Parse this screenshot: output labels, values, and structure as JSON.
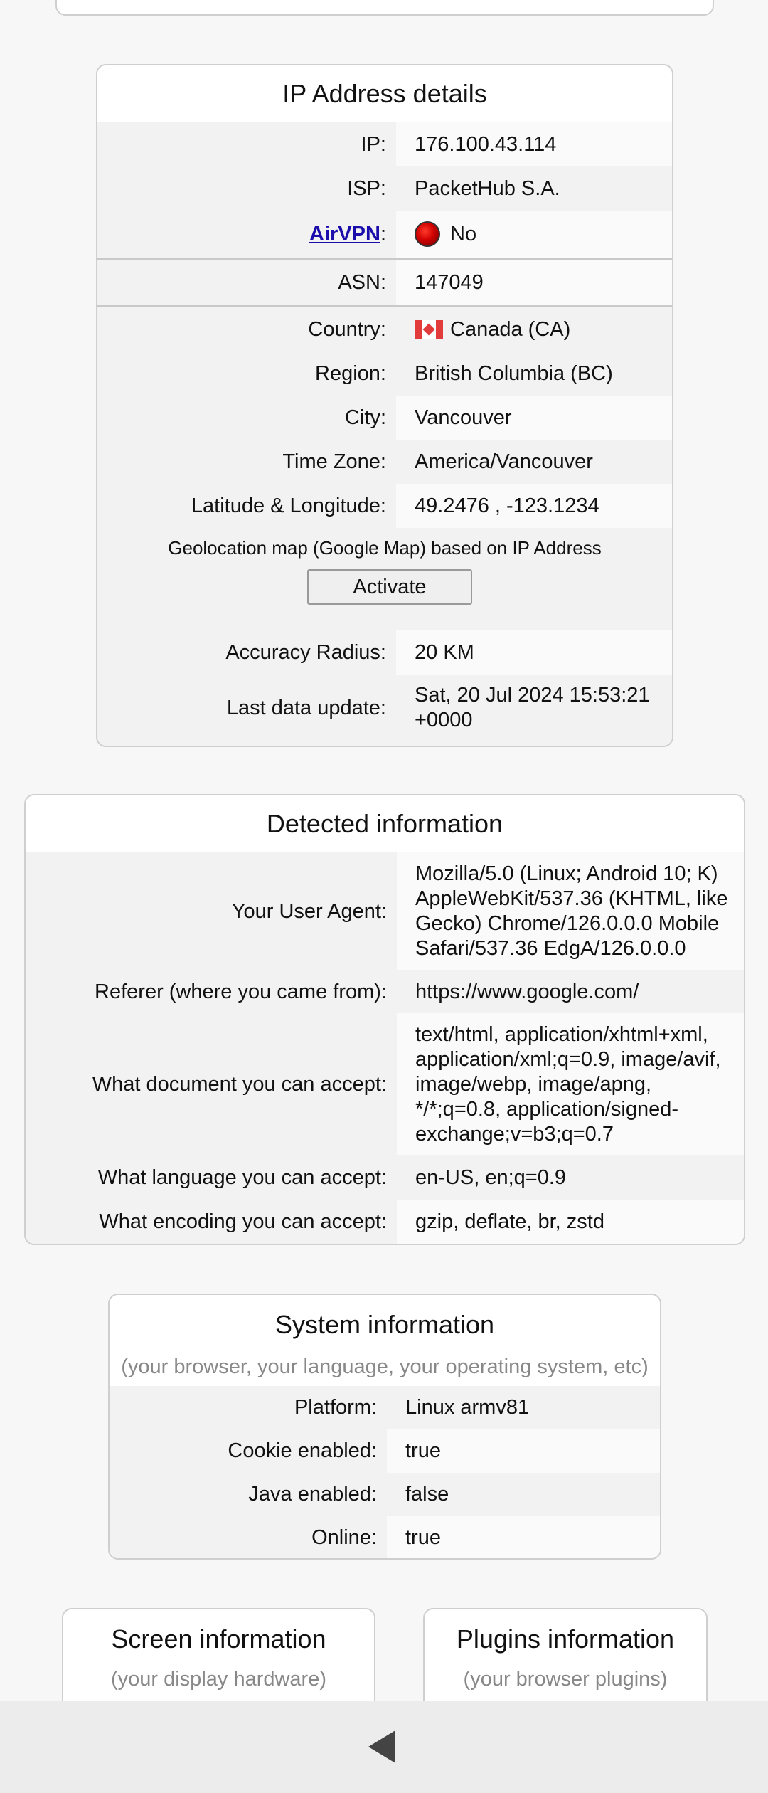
{
  "ip_card": {
    "title": "IP Address details",
    "ip_label": "IP:",
    "ip_value": "176.100.43.114",
    "isp_label": "ISP:",
    "isp_value": "PacketHub S.A.",
    "airvpn_link": "AirVPN",
    "airvpn_colon": ":",
    "airvpn_value": "No",
    "asn_label": "ASN:",
    "asn_value": "147049",
    "country_label": "Country:",
    "country_value": "Canada (CA)",
    "region_label": "Region:",
    "region_value": "British Columbia (BC)",
    "city_label": "City:",
    "city_value": "Vancouver",
    "timezone_label": "Time Zone:",
    "timezone_value": "America/Vancouver",
    "latlng_label": "Latitude & Longitude:",
    "latlng_value": "49.2476 , -123.1234",
    "map_note": "Geolocation map (Google Map) based on IP Address",
    "activate_button": "Activate",
    "accuracy_label": "Accuracy Radius:",
    "accuracy_value": "20 KM",
    "lastupdate_label": "Last data update:",
    "lastupdate_value": "Sat, 20 Jul 2024 15:53:21 +0000"
  },
  "detected_card": {
    "title": "Detected information",
    "ua_label": "Your User Agent:",
    "ua_value": "Mozilla/5.0 (Linux; Android 10; K) AppleWebKit/537.36 (KHTML, like Gecko) Chrome/126.0.0.0 Mobile Safari/537.36 EdgA/126.0.0.0",
    "referer_label": "Referer (where you came from):",
    "referer_value": "https://www.google.com/",
    "accept_label": "What document you can accept:",
    "accept_value": "text/html, application/xhtml+xml, application/xml;q=0.9, image/avif, image/webp, image/apng, */*;q=0.8, application/signed-exchange;v=b3;q=0.7",
    "language_label": "What language you can accept:",
    "language_value": "en-US, en;q=0.9",
    "encoding_label": "What encoding you can accept:",
    "encoding_value": "gzip, deflate, br, zstd"
  },
  "system_card": {
    "title": "System information",
    "subtitle": "(your browser, your language, your operating system, etc)",
    "platform_label": "Platform:",
    "platform_value": "Linux armv81",
    "cookie_label": "Cookie enabled:",
    "cookie_value": "true",
    "java_label": "Java enabled:",
    "java_value": "false",
    "online_label": "Online:",
    "online_value": "true"
  },
  "screen_card": {
    "title": "Screen information",
    "subtitle": "(your display hardware)"
  },
  "plugins_card": {
    "title": "Plugins information",
    "subtitle": "(your browser plugins)"
  },
  "icons": {
    "status": "red-dot-icon",
    "flag": "canada-flag-icon",
    "nav_back": "back-triangle-icon"
  },
  "colors": {
    "link": "#1a0dab",
    "status_red": "#d00000"
  }
}
